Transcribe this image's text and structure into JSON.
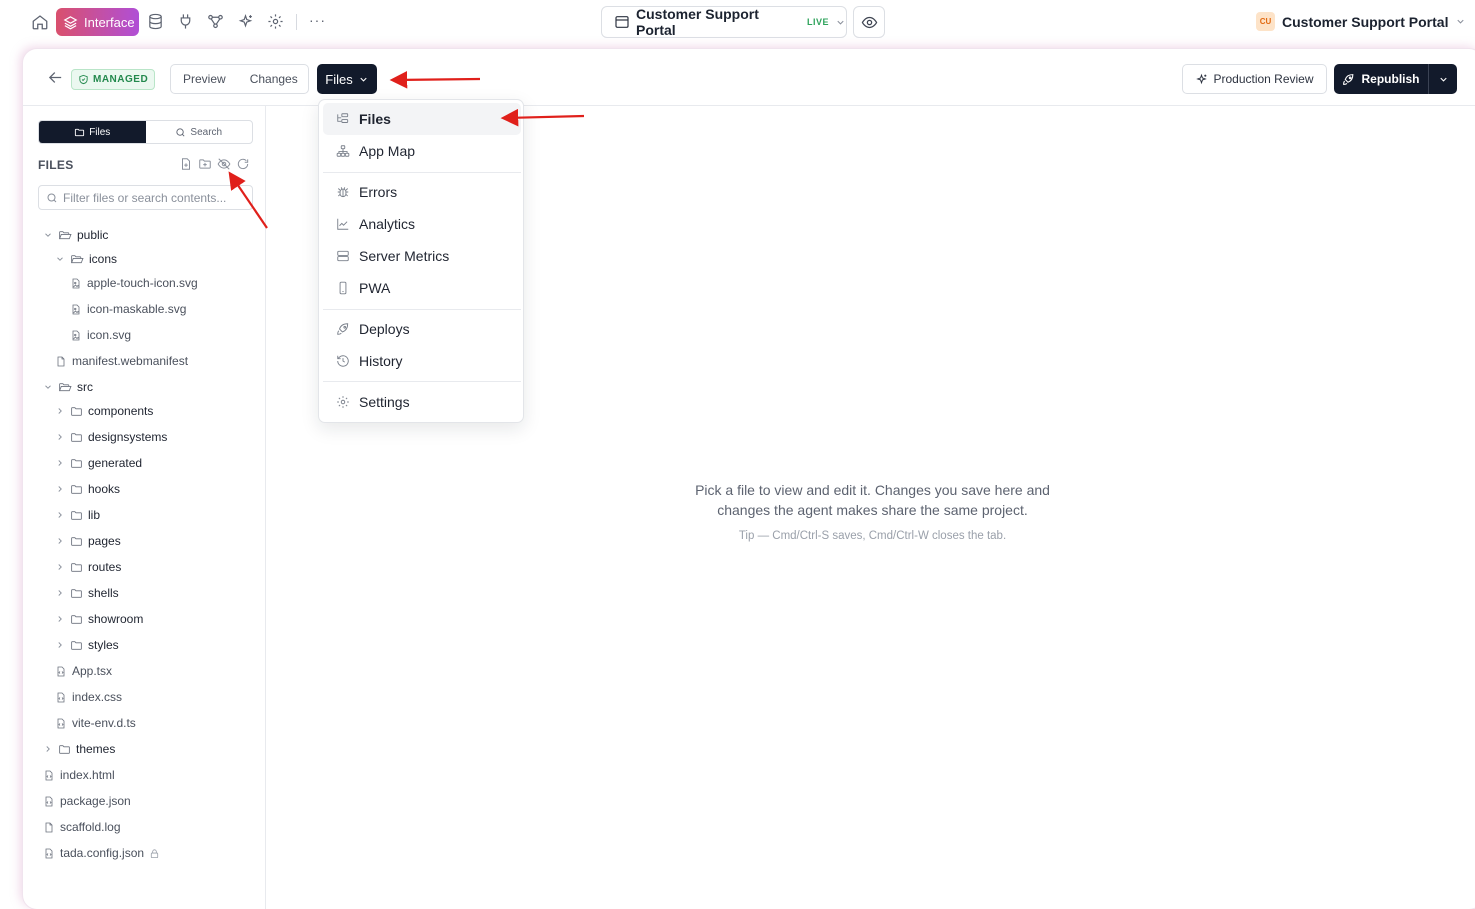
{
  "topbar": {
    "interface_label": "Interface",
    "more_label": "···",
    "project_title": "Customer Support Portal",
    "live_badge": "LIVE",
    "account_initials": "CU",
    "account_name": "Customer Support Portal",
    "icons": [
      "home-icon",
      "database-icon",
      "plug-icon",
      "workflow-icon",
      "sparkles-icon",
      "gear-icon"
    ]
  },
  "header": {
    "managed_badge": "MANAGED",
    "preview_label": "Preview",
    "changes_label": "Changes",
    "files_label": "Files",
    "production_review_label": "Production Review",
    "republish_label": "Republish"
  },
  "sidebar": {
    "tab_files": "Files",
    "tab_search": "Search",
    "files_heading": "FILES",
    "filter_placeholder": "Filter files or search contents...",
    "tree": [
      {
        "name": "public",
        "type": "folder",
        "depth": 0,
        "open": true
      },
      {
        "name": "icons",
        "type": "folder",
        "depth": 1,
        "open": true
      },
      {
        "name": "apple-touch-icon.svg",
        "type": "image",
        "depth": 2
      },
      {
        "name": "icon-maskable.svg",
        "type": "image",
        "depth": 2
      },
      {
        "name": "icon.svg",
        "type": "image",
        "depth": 2
      },
      {
        "name": "manifest.webmanifest",
        "type": "file",
        "depth": 1
      },
      {
        "name": "src",
        "type": "folder",
        "depth": 0,
        "open": true
      },
      {
        "name": "components",
        "type": "folder",
        "depth": 1,
        "open": false
      },
      {
        "name": "designsystems",
        "type": "folder",
        "depth": 1,
        "open": false
      },
      {
        "name": "generated",
        "type": "folder",
        "depth": 1,
        "open": false
      },
      {
        "name": "hooks",
        "type": "folder",
        "depth": 1,
        "open": false
      },
      {
        "name": "lib",
        "type": "folder",
        "depth": 1,
        "open": false
      },
      {
        "name": "pages",
        "type": "folder",
        "depth": 1,
        "open": false
      },
      {
        "name": "routes",
        "type": "folder",
        "depth": 1,
        "open": false
      },
      {
        "name": "shells",
        "type": "folder",
        "depth": 1,
        "open": false
      },
      {
        "name": "showroom",
        "type": "folder",
        "depth": 1,
        "open": false
      },
      {
        "name": "styles",
        "type": "folder",
        "depth": 1,
        "open": false
      },
      {
        "name": "App.tsx",
        "type": "code",
        "depth": 1
      },
      {
        "name": "index.css",
        "type": "code",
        "depth": 1
      },
      {
        "name": "vite-env.d.ts",
        "type": "code",
        "depth": 1
      },
      {
        "name": "themes",
        "type": "folder",
        "depth": 0,
        "open": false
      },
      {
        "name": "index.html",
        "type": "code",
        "depth": 0
      },
      {
        "name": "package.json",
        "type": "code",
        "depth": 0
      },
      {
        "name": "scaffold.log",
        "type": "file",
        "depth": 0
      },
      {
        "name": "tada.config.json",
        "type": "code",
        "depth": 0,
        "locked": true
      }
    ]
  },
  "menu": {
    "items": [
      {
        "label": "Files",
        "icon": "file-tree-icon",
        "active": true
      },
      {
        "label": "App Map",
        "icon": "sitemap-icon"
      },
      {
        "label": "Errors",
        "icon": "bug-icon"
      },
      {
        "label": "Analytics",
        "icon": "chart-line-icon"
      },
      {
        "label": "Server Metrics",
        "icon": "server-icon"
      },
      {
        "label": "PWA",
        "icon": "smartphone-icon"
      },
      {
        "label": "Deploys",
        "icon": "rocket-icon"
      },
      {
        "label": "History",
        "icon": "history-icon"
      },
      {
        "label": "Settings",
        "icon": "gear-icon"
      }
    ]
  },
  "empty_state": {
    "message": "Pick a file to view and edit it. Changes you save here and changes the agent makes share the same project.",
    "tip": "Tip — Cmd/Ctrl-S saves, Cmd/Ctrl-W closes the tab."
  },
  "colors": {
    "accent_dark": "#121a2b",
    "live_green": "#2fa35c",
    "managed_green": "#23894d",
    "annotation_red": "#e0201b",
    "interface_gradient": [
      "#d9506d",
      "#b04fd6"
    ]
  }
}
